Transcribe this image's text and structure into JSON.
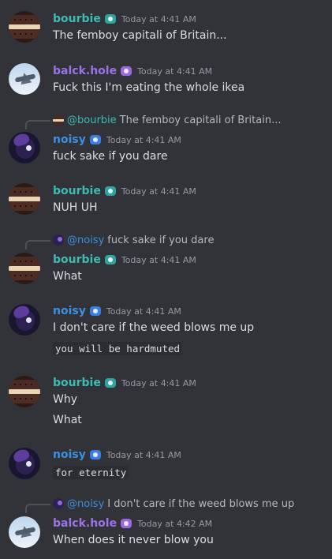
{
  "messages": [
    {
      "user": "bourbie",
      "time": "Today at 4:41 AM",
      "lines": [
        "The femboy capitali of Britain..."
      ]
    },
    {
      "user": "balck.hole",
      "time": "Today at 4:41 AM",
      "lines": [
        "Fuck this I'm eating the whole ikea"
      ]
    },
    {
      "reply_to": "@bourbie",
      "reply_text": "The femboy capitali of Britain...",
      "user": "noisy",
      "time": "Today at 4:41 AM",
      "lines": [
        "fuck sake if you dare"
      ]
    },
    {
      "user": "bourbie",
      "time": "Today at 4:41 AM",
      "lines": [
        "NUH UH"
      ]
    },
    {
      "reply_to": "@noisy",
      "reply_text": "fuck sake if you dare",
      "user": "bourbie",
      "time": "Today at 4:41 AM",
      "lines": [
        "What"
      ]
    },
    {
      "user": "noisy",
      "time": "Today at 4:41 AM",
      "lines": [
        "I don't care if the weed blows me up"
      ],
      "code": "you will be hardmuted"
    },
    {
      "user": "bourbie",
      "time": "Today at 4:41 AM",
      "lines": [
        "Why",
        "What"
      ]
    },
    {
      "user": "noisy",
      "time": "Today at 4:41 AM",
      "code": "for eternity"
    },
    {
      "reply_to": "@noisy",
      "reply_text": "I don't care if the weed blows me up",
      "user": "balck.hole",
      "time": "Today at 4:42 AM",
      "lines": [
        "When does it never blow you"
      ]
    }
  ],
  "icons": {
    "badge_bourbie": "teal-badge-icon",
    "badge_black": "purple-badge-icon",
    "badge_noisy": "blue-badge-icon"
  },
  "colors": {
    "background": "#313338",
    "bourbie": "#3ebbb1",
    "balck_hole": "#9b72e8",
    "noisy": "#3d8fe0"
  }
}
